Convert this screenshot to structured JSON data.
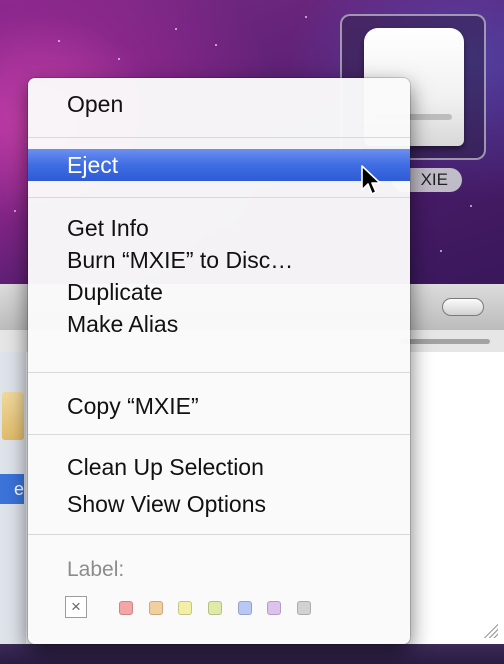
{
  "desktop": {
    "drive": {
      "icon": "external-drive-icon",
      "label_visible": "XIE"
    }
  },
  "context_menu": {
    "sections": [
      {
        "items": [
          {
            "label": "Open",
            "highlighted": false
          }
        ]
      },
      {
        "items": [
          {
            "label": "Eject",
            "highlighted": true
          }
        ]
      },
      {
        "items": [
          {
            "label": "Get Info",
            "highlighted": false
          },
          {
            "label": "Burn “MXIE” to Disc…",
            "highlighted": false
          },
          {
            "label": "Duplicate",
            "highlighted": false
          },
          {
            "label": "Make Alias",
            "highlighted": false
          }
        ]
      },
      {
        "items": [
          {
            "label": "Copy “MXIE”",
            "highlighted": false
          }
        ]
      },
      {
        "items": [
          {
            "label": "Clean Up Selection",
            "highlighted": false
          },
          {
            "label": "Show View Options",
            "highlighted": false
          }
        ]
      }
    ],
    "label_section": {
      "heading": "Label:",
      "none_glyph": "×",
      "colors": [
        "#f4a6a6",
        "#f2cf9e",
        "#f3efa6",
        "#dfeaa6",
        "#b6c8f3",
        "#dcc3ee",
        "#d2d2d2"
      ]
    }
  },
  "finder_window": {
    "sidebar_selected_fragment": "e"
  },
  "colors": {
    "highlight_top": "#6b8ff0",
    "highlight_bottom": "#2f5bd6"
  }
}
